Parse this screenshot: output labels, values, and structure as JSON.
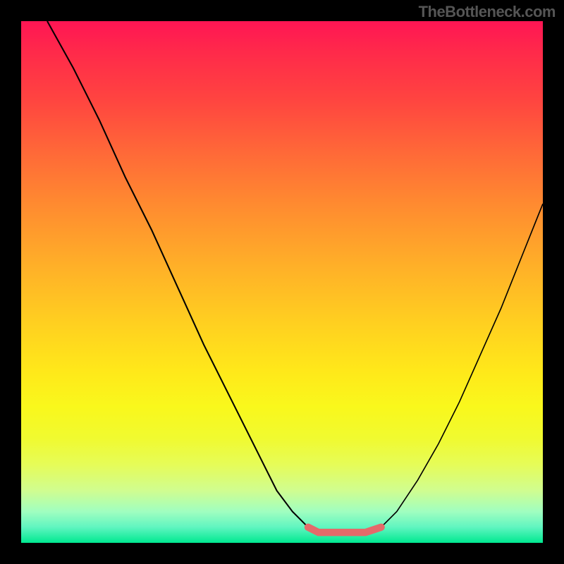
{
  "attribution": "TheBottleneck.com",
  "chart_data": {
    "type": "line",
    "title": "",
    "xlabel": "",
    "ylabel": "",
    "xlim": [
      0,
      100
    ],
    "ylim": [
      0,
      100
    ],
    "colors": {
      "background_gradient_top": "#ff1554",
      "background_gradient_bottom": "#00e890",
      "curve_stroke": "#000000",
      "valley_marker": "#e46a6a",
      "frame": "#000000"
    },
    "series": [
      {
        "name": "left-curve",
        "stroke": "#000000",
        "x": [
          5,
          10,
          15,
          20,
          25,
          30,
          35,
          40,
          45,
          49,
          52,
          55
        ],
        "y": [
          100,
          91,
          81,
          70,
          60,
          49,
          38,
          28,
          18,
          10,
          6,
          3
        ]
      },
      {
        "name": "valley-marker",
        "stroke": "#e46a6a",
        "x": [
          55,
          57,
          60,
          63,
          66,
          69
        ],
        "y": [
          3,
          2,
          2,
          2,
          2,
          3
        ]
      },
      {
        "name": "right-curve",
        "stroke": "#000000",
        "x": [
          69,
          72,
          76,
          80,
          84,
          88,
          92,
          96,
          100
        ],
        "y": [
          3,
          6,
          12,
          19,
          27,
          36,
          45,
          55,
          65
        ]
      }
    ]
  }
}
